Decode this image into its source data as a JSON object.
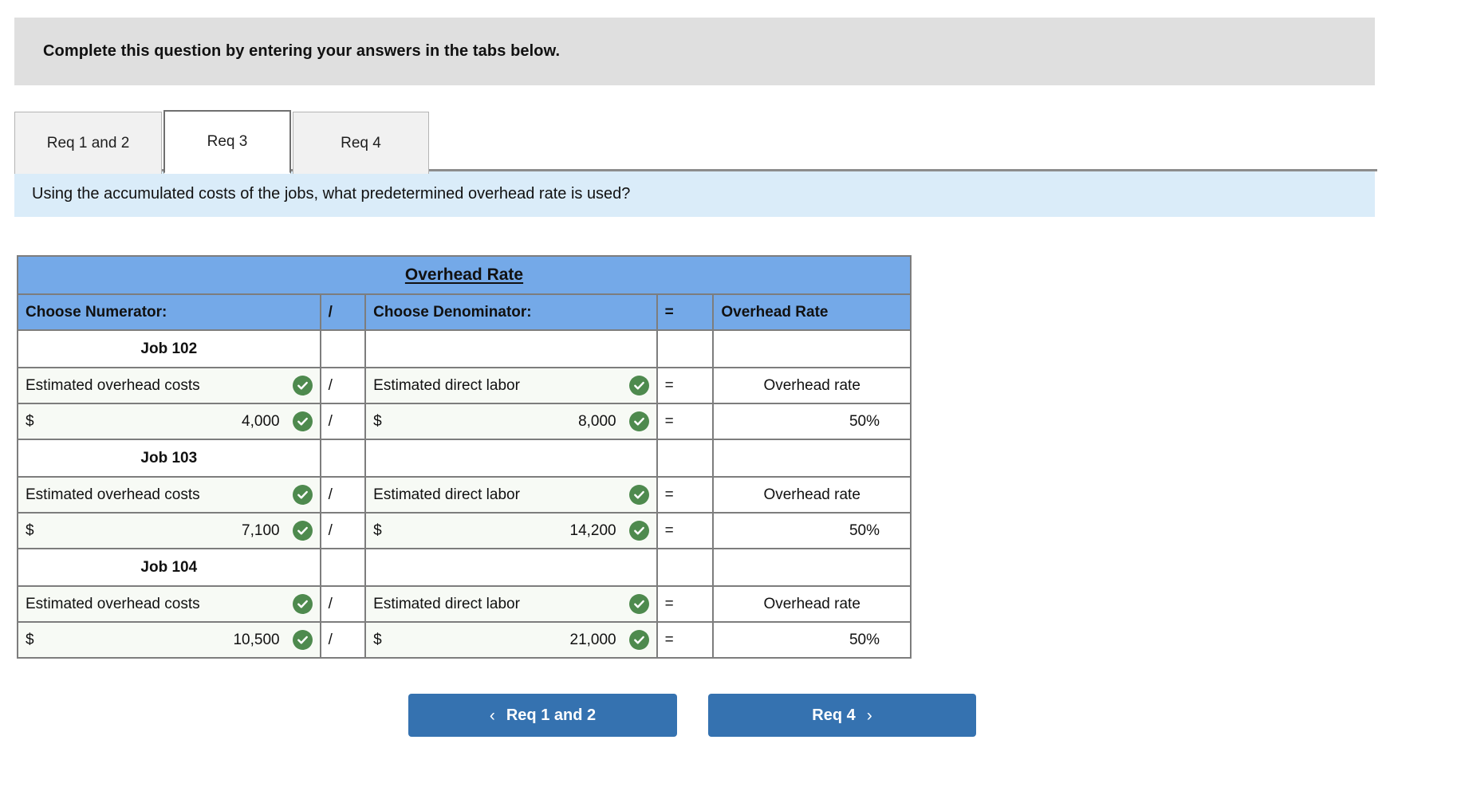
{
  "instruction": {
    "text": "Complete this question by entering your answers in the tabs below."
  },
  "tabs": [
    {
      "label": "Req 1 and 2",
      "active": false
    },
    {
      "label": "Req 3",
      "active": true
    },
    {
      "label": "Req 4",
      "active": false
    }
  ],
  "question": {
    "text": "Using the accumulated costs of the jobs, what predetermined overhead rate is used?"
  },
  "table": {
    "title": "Overhead Rate",
    "headers": {
      "numerator": "Choose Numerator:",
      "slash": "/",
      "denominator": "Choose Denominator:",
      "equals": "=",
      "rate": "Overhead Rate"
    },
    "check_icon": "check-circle-icon",
    "groups": [
      {
        "job": "Job 102",
        "label_row": {
          "numerator": "Estimated overhead costs",
          "numerator_check": true,
          "slash": "/",
          "denominator": "Estimated direct labor",
          "denominator_check": true,
          "equals": "=",
          "rate": "Overhead rate"
        },
        "value_row": {
          "numerator_currency": "$",
          "numerator": "4,000",
          "numerator_check": true,
          "slash": "/",
          "denominator_currency": "$",
          "denominator": "8,000",
          "denominator_check": true,
          "equals": "=",
          "rate": "50%"
        }
      },
      {
        "job": "Job 103",
        "label_row": {
          "numerator": "Estimated overhead costs",
          "numerator_check": true,
          "slash": "/",
          "denominator": "Estimated direct labor",
          "denominator_check": true,
          "equals": "=",
          "rate": "Overhead rate"
        },
        "value_row": {
          "numerator_currency": "$",
          "numerator": "7,100",
          "numerator_check": true,
          "slash": "/",
          "denominator_currency": "$",
          "denominator": "14,200",
          "denominator_check": true,
          "equals": "=",
          "rate": "50%"
        }
      },
      {
        "job": "Job 104",
        "label_row": {
          "numerator": "Estimated overhead costs",
          "numerator_check": true,
          "slash": "/",
          "denominator": "Estimated direct labor",
          "denominator_check": true,
          "equals": "=",
          "rate": "Overhead rate"
        },
        "value_row": {
          "numerator_currency": "$",
          "numerator": "10,500",
          "numerator_check": true,
          "slash": "/",
          "denominator_currency": "$",
          "denominator": "21,000",
          "denominator_check": true,
          "equals": "=",
          "rate": "50%"
        }
      }
    ]
  },
  "nav": {
    "prev_label": "Req 1 and 2",
    "prev_icon": "chevron-left-icon",
    "next_label": "Req 4",
    "next_icon": "chevron-right-icon"
  },
  "colors": {
    "instruction_bar": "#dfdfdf",
    "question_banner": "#daecf9",
    "table_header_blue": "#74a9e8",
    "check_green": "#4e8a4e",
    "button_blue": "#3572b0",
    "row_tint": "#f7faf5",
    "border_gray": "#7d7d7d"
  }
}
